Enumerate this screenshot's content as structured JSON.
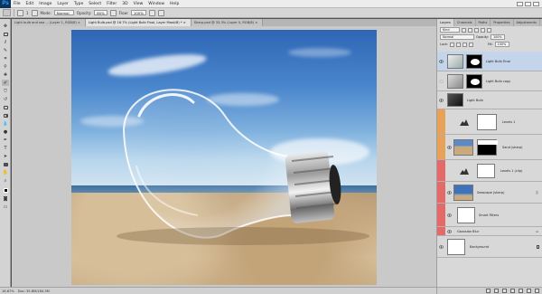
{
  "app": {
    "logo": "Ps"
  },
  "menu": [
    "File",
    "Edit",
    "Image",
    "Layer",
    "Type",
    "Select",
    "Filter",
    "3D",
    "View",
    "Window",
    "Help"
  ],
  "options": {
    "size_value": "1",
    "mode_label": "Mode:",
    "mode_value": "Normal",
    "opacity_label": "Opacity:",
    "opacity_value": "80%",
    "flow_label": "Flow:",
    "flow_value": "100%"
  },
  "tabs": [
    {
      "label": "Light bulb and sea ... (Layer 1, RGB/8) ×"
    },
    {
      "label": "Light Bulb.psd @ 16.7% (Light Bulb Final, Layer Mask/8) * ×"
    },
    {
      "label": "Sharp.psd @ 33.3% (Layer 0, RGB/8) ×"
    }
  ],
  "status": {
    "zoom": "16.67%",
    "doc": "Doc: 35.8M/184.3M"
  },
  "panel": {
    "tabs": [
      "Layers",
      "Channels",
      "Paths",
      "Properties",
      "Adjustments"
    ],
    "kind_label": "Kind",
    "blend_mode": "Normal",
    "opacity_label": "Opacity:",
    "opacity_value": "100%",
    "lock_label": "Lock:",
    "fill_label": "Fill:",
    "fill_value": "100%"
  },
  "layers": [
    {
      "name": "Light Bulb Final"
    },
    {
      "name": "Light Bulb copy"
    },
    {
      "name": "Light Bulb"
    },
    {
      "name": "Levels 1"
    },
    {
      "name": "Sand (sharp)"
    },
    {
      "name": "Levels 1 (clip)"
    },
    {
      "name": "Seascape (sharp)"
    },
    {
      "name": "Smart Filters"
    },
    {
      "name": "Gaussian Blur"
    },
    {
      "name": "Background"
    }
  ],
  "colors": {
    "layer_orange": "#e7a159",
    "layer_red": "#e46a6a",
    "selected": "#c4d4ea"
  }
}
